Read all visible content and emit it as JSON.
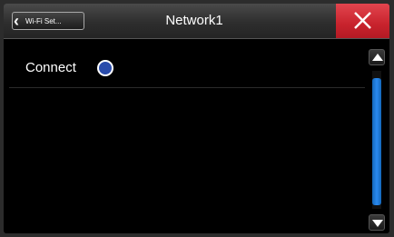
{
  "header": {
    "back_label": "Wi-Fi Set...",
    "title": "Network1"
  },
  "list": {
    "items": [
      {
        "label": "Connect",
        "selected": true
      }
    ]
  },
  "scrollbar": {
    "thumb_color": "#2a8af0"
  },
  "colors": {
    "close_button": "#d4303a",
    "radio_fill": "#2a4cab"
  }
}
